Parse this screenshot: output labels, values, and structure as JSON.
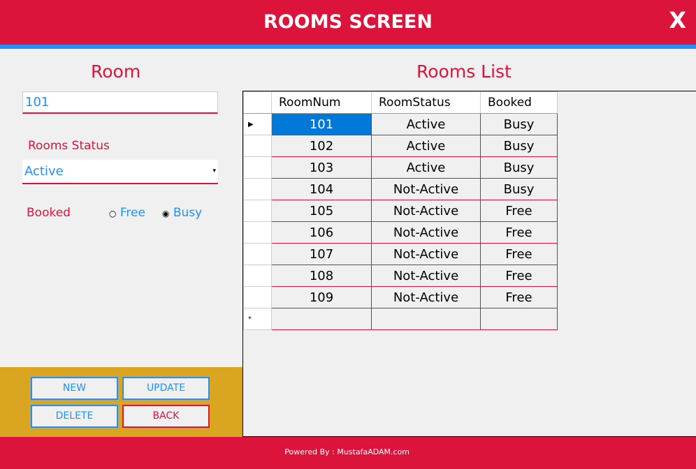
{
  "header": {
    "title": "ROOMS SCREEN",
    "close": "X"
  },
  "form": {
    "section_title": "Room",
    "room_value": "101",
    "status_label": "Rooms Status",
    "status_value": "Active",
    "booked_label": "Booked",
    "radio_free": "Free",
    "radio_busy": "Busy",
    "selected_radio": "Busy"
  },
  "buttons": {
    "new": "NEW",
    "update": "UPDATE",
    "delete": "DELETE",
    "back": "BACK"
  },
  "list": {
    "title": "Rooms List",
    "columns": [
      "RoomNum",
      "RoomStatus",
      "Booked"
    ],
    "rows": [
      [
        "101",
        "Active",
        "Busy"
      ],
      [
        "102",
        "Active",
        "Busy"
      ],
      [
        "103",
        "Active",
        "Busy"
      ],
      [
        "104",
        "Not-Active",
        "Busy"
      ],
      [
        "105",
        "Not-Active",
        "Free"
      ],
      [
        "106",
        "Not-Active",
        "Free"
      ],
      [
        "107",
        "Not-Active",
        "Free"
      ],
      [
        "108",
        "Not-Active",
        "Free"
      ],
      [
        "109",
        "Not-Active",
        "Free"
      ]
    ]
  },
  "footer": {
    "text": "Powered By : MustafaADAM.com"
  },
  "colors": {
    "accent": "#dc143c",
    "blue": "#1e90ff",
    "gold": "#daa520",
    "selection": "#0078d7"
  }
}
